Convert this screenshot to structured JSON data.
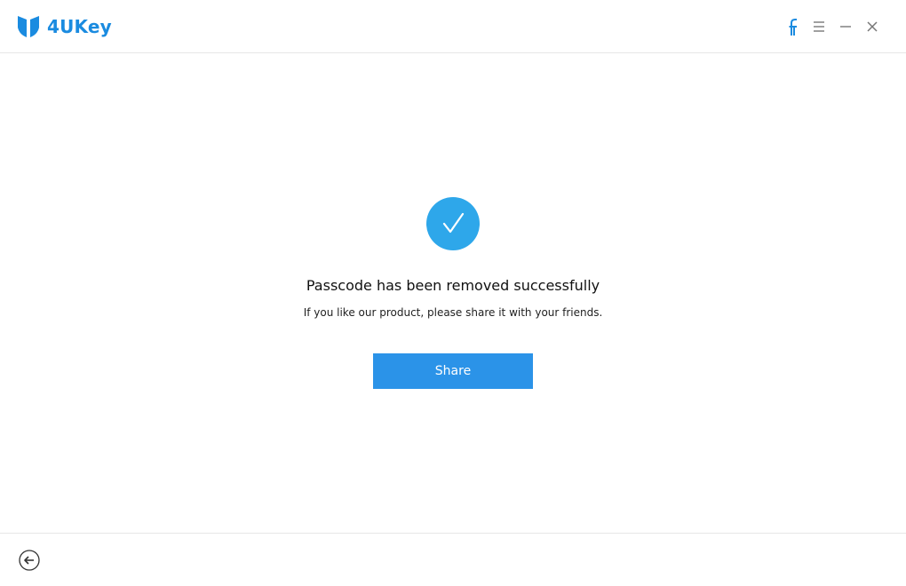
{
  "app": {
    "name": "4UKey",
    "brand_color": "#1a8be0"
  },
  "titlebar": {
    "controls": [
      {
        "name": "facebook-icon",
        "icon": "facebook"
      },
      {
        "name": "menu-icon",
        "icon": "hamburger"
      },
      {
        "name": "minimize-icon",
        "icon": "minus"
      },
      {
        "name": "close-icon",
        "icon": "x"
      }
    ]
  },
  "main": {
    "status_icon": "checkmark-circle",
    "status_color": "#2ea7ea",
    "headline": "Passcode has been removed successfully",
    "subline": "If you like our product, please share it with your friends.",
    "share_label": "Share",
    "button_color": "#2b93e8"
  },
  "footer": {
    "back_icon": "back-arrow-circle"
  }
}
